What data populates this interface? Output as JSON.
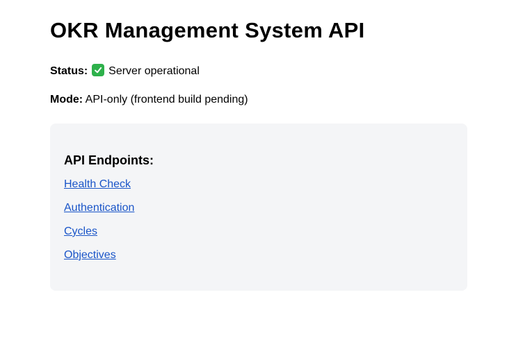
{
  "page": {
    "title": "OKR Management System API"
  },
  "status": {
    "label": "Status:",
    "icon": "check-mark-icon",
    "icon_color": "#2eb14b",
    "text": "Server operational"
  },
  "mode": {
    "label": "Mode:",
    "text": "API-only (frontend build pending)"
  },
  "endpoints": {
    "heading": "API Endpoints:",
    "links": [
      {
        "label": "Health Check"
      },
      {
        "label": "Authentication"
      },
      {
        "label": "Cycles"
      },
      {
        "label": "Objectives"
      }
    ],
    "link_color": "#1a55c8",
    "panel_color": "#f4f5f7"
  }
}
